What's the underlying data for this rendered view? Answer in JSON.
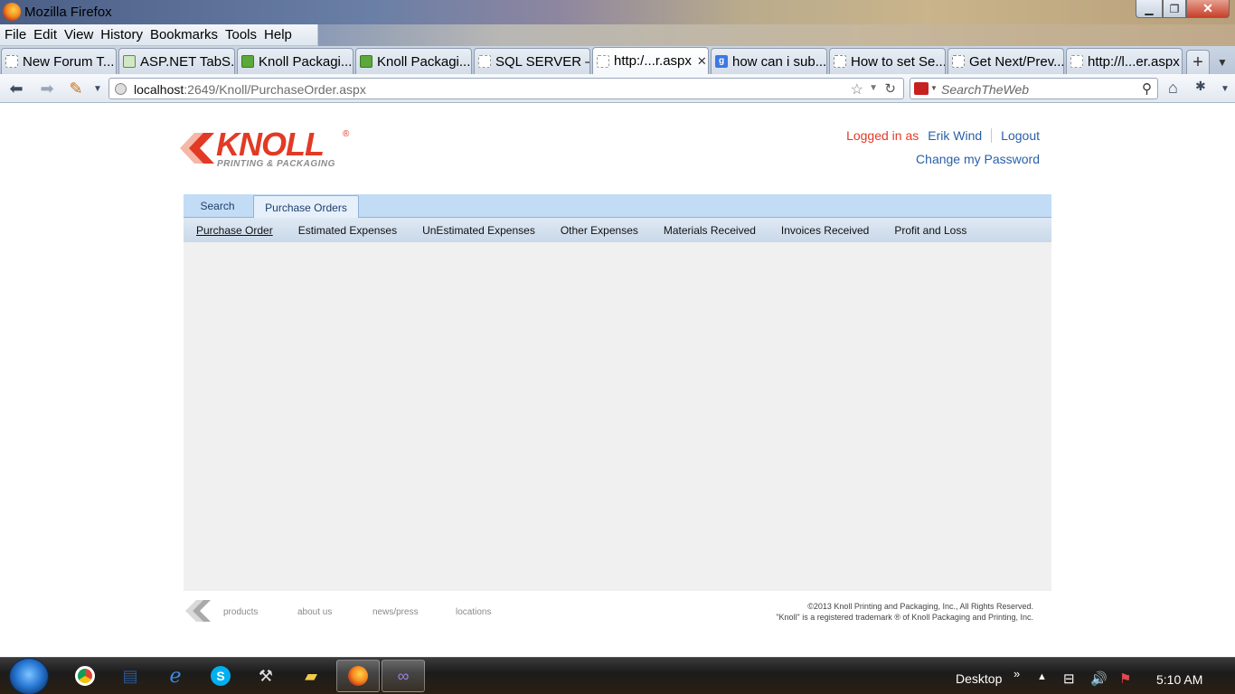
{
  "window": {
    "title": "Mozilla Firefox"
  },
  "menu": {
    "items": [
      "File",
      "Edit",
      "View",
      "History",
      "Bookmarks",
      "Tools",
      "Help"
    ]
  },
  "tabs": [
    {
      "label": "New Forum T...",
      "icon": "page-icon"
    },
    {
      "label": "ASP.NET TabS...",
      "icon": "asp-icon"
    },
    {
      "label": "Knoll Packagi...",
      "icon": "knoll-site-icon"
    },
    {
      "label": "Knoll Packagi...",
      "icon": "knoll-site-icon"
    },
    {
      "label": "SQL SERVER –...",
      "icon": "page-icon"
    },
    {
      "label": "http:/...r.aspx",
      "icon": "page-icon",
      "active": true
    },
    {
      "label": "how can i sub...",
      "icon": "google-icon"
    },
    {
      "label": "How to set Se...",
      "icon": "page-icon"
    },
    {
      "label": "Get Next/Prev...",
      "icon": "page-icon"
    },
    {
      "label": "http://l...er.aspx",
      "icon": "page-icon"
    }
  ],
  "nav": {
    "url_host": "localhost",
    "url_rest": ":2649/Knoll/PurchaseOrder.aspx",
    "search_placeholder": "SearchTheWeb"
  },
  "page": {
    "logo": {
      "brand": "KNOLL",
      "reg": "®",
      "tagline": "PRINTING & PACKAGING"
    },
    "login": {
      "logged_in_as": "Logged in as",
      "user": "Erik Wind",
      "logout": "Logout",
      "change_password": "Change my Password"
    },
    "main_tabs": [
      "Search",
      "Purchase Orders"
    ],
    "sub_tabs": [
      "Purchase Order",
      "Estimated Expenses",
      "UnEstimated Expenses",
      "Other Expenses",
      "Materials Received",
      "Invoices Received",
      "Profit and Loss"
    ],
    "footer": {
      "links": [
        "products",
        "about us",
        "news/press",
        "locations"
      ],
      "copyright_1": "©2013 Knoll Printing and Packaging, Inc., All Rights Reserved.",
      "copyright_2": "\"Knoll\" is a registered trademark ® of Knoll Packaging and Printing, Inc."
    }
  },
  "taskbar": {
    "desktop_label": "Desktop",
    "clock": "5:10 AM"
  },
  "colors": {
    "brand_red": "#e23a25",
    "link_blue": "#2a5fa8",
    "tab_blue": "#c3dcf6"
  }
}
